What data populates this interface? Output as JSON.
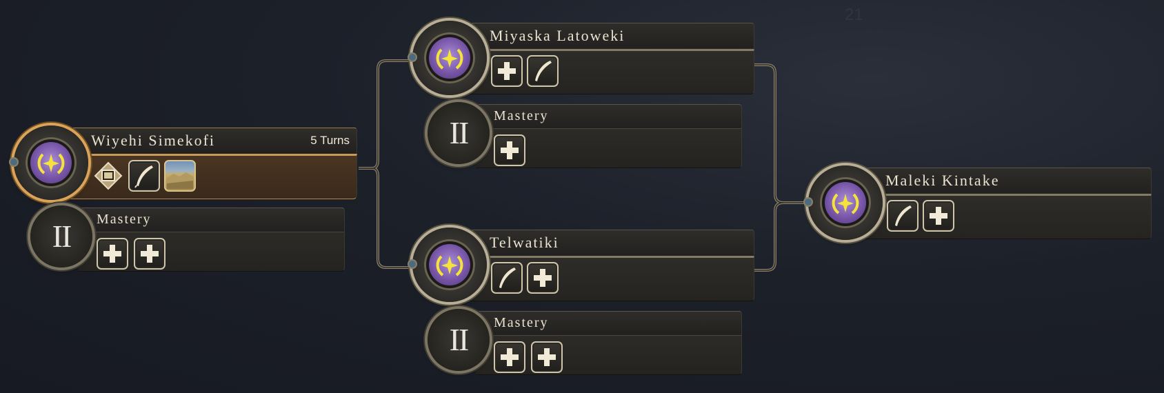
{
  "background_marker": "21",
  "nodes": {
    "wiyehi": {
      "name": "Wiyehi Simekofi",
      "turns": "5 Turns",
      "icons": [
        "cartography-icon",
        "quill-icon",
        "landscape-icon"
      ]
    },
    "miyaska": {
      "name": "Miyaska Latoweki",
      "icons": [
        "plus-icon",
        "quill-icon"
      ]
    },
    "telwatiki": {
      "name": "Telwatiki",
      "icons": [
        "quill-icon",
        "plus-icon"
      ]
    },
    "maleki": {
      "name": "Maleki Kintake",
      "icons": [
        "quill-icon",
        "plus-icon"
      ]
    }
  },
  "masteries": {
    "wiyehi": {
      "label": "Mastery",
      "numeral": "II",
      "icons": [
        "plus-icon",
        "plus-icon"
      ]
    },
    "miyaska": {
      "label": "Mastery",
      "numeral": "II",
      "icons": [
        "plus-icon"
      ]
    },
    "telwatiki": {
      "label": "Mastery",
      "numeral": "II",
      "icons": [
        "plus-icon",
        "plus-icon"
      ]
    }
  },
  "colors": {
    "accent_gold": "#c89b55",
    "medal_purple": "#7856a8",
    "laurel_yellow": "#f5e23a"
  }
}
